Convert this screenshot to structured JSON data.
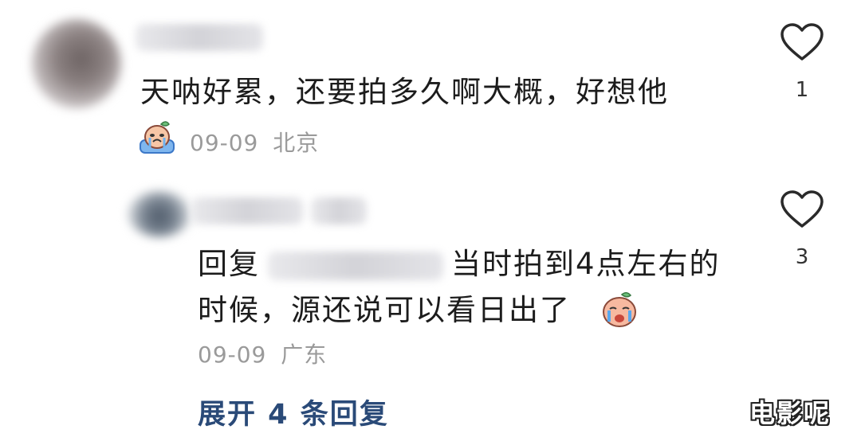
{
  "comment": {
    "text": "天呐好累，还要拍多久啊大概，好想他",
    "date": "09-09",
    "location": "北京",
    "like_count": "1",
    "badge_icon": "crying-peach-emoji"
  },
  "reply": {
    "prefix": "回复",
    "text_line1": "当时拍到4点左右的",
    "text_line2": "时候，源还说可以看日出了",
    "date": "09-09",
    "location": "广东",
    "like_count": "3",
    "emoji_icon": "crying-peach-emoji"
  },
  "expand_label": "展开 4 条回复",
  "watermark": "电影呢",
  "colors": {
    "meta": "#9a9a9a",
    "expand": "#2a4a78",
    "text": "#1c1c1c"
  }
}
